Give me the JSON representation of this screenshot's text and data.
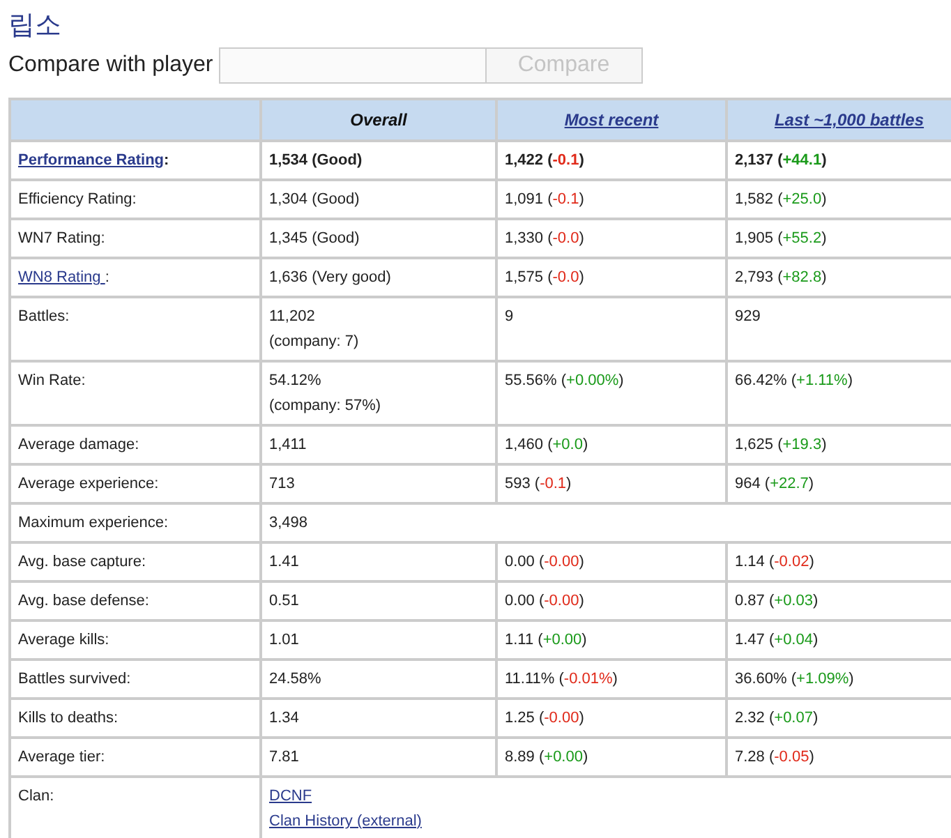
{
  "title": "립소",
  "compare": {
    "label": "Compare with player",
    "button": "Compare",
    "button_disabled": true
  },
  "table": {
    "columns": [
      {
        "label": "Overall",
        "kind": "plain"
      },
      {
        "label": "Most recent",
        "kind": "link"
      },
      {
        "label": "Last ~1,000 battles",
        "kind": "link"
      }
    ],
    "rows": [
      {
        "label": {
          "text": "Performance Rating",
          "link": true,
          "suffix": ":"
        },
        "bold": true,
        "cells": [
          {
            "lines": [
              [
                {
                  "text": "1,534 (Good)"
                }
              ]
            ]
          },
          {
            "lines": [
              [
                {
                  "text": "1,422 ("
                },
                {
                  "text": "-0.1",
                  "kind": "loss"
                },
                {
                  "text": ")"
                }
              ]
            ]
          },
          {
            "lines": [
              [
                {
                  "text": "2,137 ("
                },
                {
                  "text": "+44.1",
                  "kind": "gain"
                },
                {
                  "text": ")"
                }
              ]
            ]
          }
        ]
      },
      {
        "label": {
          "text": "Efficiency Rating:",
          "link": false
        },
        "bold": false,
        "cells": [
          {
            "lines": [
              [
                {
                  "text": "1,304 (Good)"
                }
              ]
            ]
          },
          {
            "lines": [
              [
                {
                  "text": "1,091 ("
                },
                {
                  "text": "-0.1",
                  "kind": "loss"
                },
                {
                  "text": ")"
                }
              ]
            ]
          },
          {
            "lines": [
              [
                {
                  "text": "1,582 ("
                },
                {
                  "text": "+25.0",
                  "kind": "gain"
                },
                {
                  "text": ")"
                }
              ]
            ]
          }
        ]
      },
      {
        "label": {
          "text": "WN7 Rating:",
          "link": false
        },
        "bold": false,
        "cells": [
          {
            "lines": [
              [
                {
                  "text": "1,345 (Good)"
                }
              ]
            ]
          },
          {
            "lines": [
              [
                {
                  "text": "1,330 ("
                },
                {
                  "text": "-0.0",
                  "kind": "loss"
                },
                {
                  "text": ")"
                }
              ]
            ]
          },
          {
            "lines": [
              [
                {
                  "text": "1,905 ("
                },
                {
                  "text": "+55.2",
                  "kind": "gain"
                },
                {
                  "text": ")"
                }
              ]
            ]
          }
        ]
      },
      {
        "label": {
          "text": "WN8 Rating ",
          "link": true,
          "suffix": ":"
        },
        "bold": false,
        "cells": [
          {
            "lines": [
              [
                {
                  "text": "1,636 (Very good)"
                }
              ]
            ]
          },
          {
            "lines": [
              [
                {
                  "text": "1,575 ("
                },
                {
                  "text": "-0.0",
                  "kind": "loss"
                },
                {
                  "text": ")"
                }
              ]
            ]
          },
          {
            "lines": [
              [
                {
                  "text": "2,793 ("
                },
                {
                  "text": "+82.8",
                  "kind": "gain"
                },
                {
                  "text": ")"
                }
              ]
            ]
          }
        ]
      },
      {
        "label": {
          "text": "Battles:",
          "link": false
        },
        "bold": false,
        "cells": [
          {
            "lines": [
              [
                {
                  "text": "11,202"
                }
              ],
              [
                {
                  "text": "(company: 7)"
                }
              ]
            ]
          },
          {
            "lines": [
              [
                {
                  "text": "9"
                }
              ]
            ]
          },
          {
            "lines": [
              [
                {
                  "text": "929"
                }
              ]
            ]
          }
        ]
      },
      {
        "label": {
          "text": "Win Rate:",
          "link": false
        },
        "bold": false,
        "cells": [
          {
            "lines": [
              [
                {
                  "text": "54.12%"
                }
              ],
              [
                {
                  "text": "(company: 57%)"
                }
              ]
            ]
          },
          {
            "lines": [
              [
                {
                  "text": "55.56% ("
                },
                {
                  "text": "+0.00%",
                  "kind": "gain"
                },
                {
                  "text": ")"
                }
              ]
            ]
          },
          {
            "lines": [
              [
                {
                  "text": "66.42% ("
                },
                {
                  "text": "+1.11%",
                  "kind": "gain"
                },
                {
                  "text": ")"
                }
              ]
            ]
          }
        ]
      },
      {
        "label": {
          "text": "Average damage:",
          "link": false
        },
        "bold": false,
        "cells": [
          {
            "lines": [
              [
                {
                  "text": "1,411"
                }
              ]
            ]
          },
          {
            "lines": [
              [
                {
                  "text": "1,460 ("
                },
                {
                  "text": "+0.0",
                  "kind": "gain"
                },
                {
                  "text": ")"
                }
              ]
            ]
          },
          {
            "lines": [
              [
                {
                  "text": "1,625 ("
                },
                {
                  "text": "+19.3",
                  "kind": "gain"
                },
                {
                  "text": ")"
                }
              ]
            ]
          }
        ]
      },
      {
        "label": {
          "text": "Average experience:",
          "link": false
        },
        "bold": false,
        "cells": [
          {
            "lines": [
              [
                {
                  "text": "713"
                }
              ]
            ]
          },
          {
            "lines": [
              [
                {
                  "text": "593 ("
                },
                {
                  "text": "-0.1",
                  "kind": "loss"
                },
                {
                  "text": ")"
                }
              ]
            ]
          },
          {
            "lines": [
              [
                {
                  "text": "964 ("
                },
                {
                  "text": "+22.7",
                  "kind": "gain"
                },
                {
                  "text": ")"
                }
              ]
            ]
          }
        ]
      },
      {
        "label": {
          "text": "Maximum experience:",
          "link": false
        },
        "bold": false,
        "cells": [
          {
            "colspan": 3,
            "lines": [
              [
                {
                  "text": "3,498"
                }
              ]
            ]
          }
        ]
      },
      {
        "label": {
          "text": "Avg. base capture:",
          "link": false
        },
        "bold": false,
        "cells": [
          {
            "lines": [
              [
                {
                  "text": "1.41"
                }
              ]
            ]
          },
          {
            "lines": [
              [
                {
                  "text": "0.00 ("
                },
                {
                  "text": "-0.00",
                  "kind": "loss"
                },
                {
                  "text": ")"
                }
              ]
            ]
          },
          {
            "lines": [
              [
                {
                  "text": "1.14 ("
                },
                {
                  "text": "-0.02",
                  "kind": "loss"
                },
                {
                  "text": ")"
                }
              ]
            ]
          }
        ]
      },
      {
        "label": {
          "text": "Avg. base defense:",
          "link": false
        },
        "bold": false,
        "cells": [
          {
            "lines": [
              [
                {
                  "text": "0.51"
                }
              ]
            ]
          },
          {
            "lines": [
              [
                {
                  "text": "0.00 ("
                },
                {
                  "text": "-0.00",
                  "kind": "loss"
                },
                {
                  "text": ")"
                }
              ]
            ]
          },
          {
            "lines": [
              [
                {
                  "text": "0.87 ("
                },
                {
                  "text": "+0.03",
                  "kind": "gain"
                },
                {
                  "text": ")"
                }
              ]
            ]
          }
        ]
      },
      {
        "label": {
          "text": "Average kills:",
          "link": false
        },
        "bold": false,
        "cells": [
          {
            "lines": [
              [
                {
                  "text": "1.01"
                }
              ]
            ]
          },
          {
            "lines": [
              [
                {
                  "text": "1.11 ("
                },
                {
                  "text": "+0.00",
                  "kind": "gain"
                },
                {
                  "text": ")"
                }
              ]
            ]
          },
          {
            "lines": [
              [
                {
                  "text": "1.47 ("
                },
                {
                  "text": "+0.04",
                  "kind": "gain"
                },
                {
                  "text": ")"
                }
              ]
            ]
          }
        ]
      },
      {
        "label": {
          "text": "Battles survived:",
          "link": false
        },
        "bold": false,
        "cells": [
          {
            "lines": [
              [
                {
                  "text": "24.58%"
                }
              ]
            ]
          },
          {
            "lines": [
              [
                {
                  "text": "11.11% ("
                },
                {
                  "text": "-0.01%",
                  "kind": "loss"
                },
                {
                  "text": ")"
                }
              ]
            ]
          },
          {
            "lines": [
              [
                {
                  "text": "36.60% ("
                },
                {
                  "text": "+1.09%",
                  "kind": "gain"
                },
                {
                  "text": ")"
                }
              ]
            ]
          }
        ]
      },
      {
        "label": {
          "text": "Kills to deaths:",
          "link": false
        },
        "bold": false,
        "cells": [
          {
            "lines": [
              [
                {
                  "text": "1.34"
                }
              ]
            ]
          },
          {
            "lines": [
              [
                {
                  "text": "1.25 ("
                },
                {
                  "text": "-0.00",
                  "kind": "loss"
                },
                {
                  "text": ")"
                }
              ]
            ]
          },
          {
            "lines": [
              [
                {
                  "text": "2.32 ("
                },
                {
                  "text": "+0.07",
                  "kind": "gain"
                },
                {
                  "text": ")"
                }
              ]
            ]
          }
        ]
      },
      {
        "label": {
          "text": "Average tier:",
          "link": false
        },
        "bold": false,
        "cells": [
          {
            "lines": [
              [
                {
                  "text": "7.81"
                }
              ]
            ]
          },
          {
            "lines": [
              [
                {
                  "text": "8.89 ("
                },
                {
                  "text": "+0.00",
                  "kind": "gain"
                },
                {
                  "text": ")"
                }
              ]
            ]
          },
          {
            "lines": [
              [
                {
                  "text": "7.28 ("
                },
                {
                  "text": "-0.05",
                  "kind": "loss"
                },
                {
                  "text": ")"
                }
              ]
            ]
          }
        ]
      },
      {
        "label": {
          "text": "Clan:",
          "link": false
        },
        "bold": false,
        "cells": [
          {
            "colspan": 3,
            "links": [
              "DCNF",
              "Clan History (external)"
            ]
          }
        ]
      }
    ]
  }
}
